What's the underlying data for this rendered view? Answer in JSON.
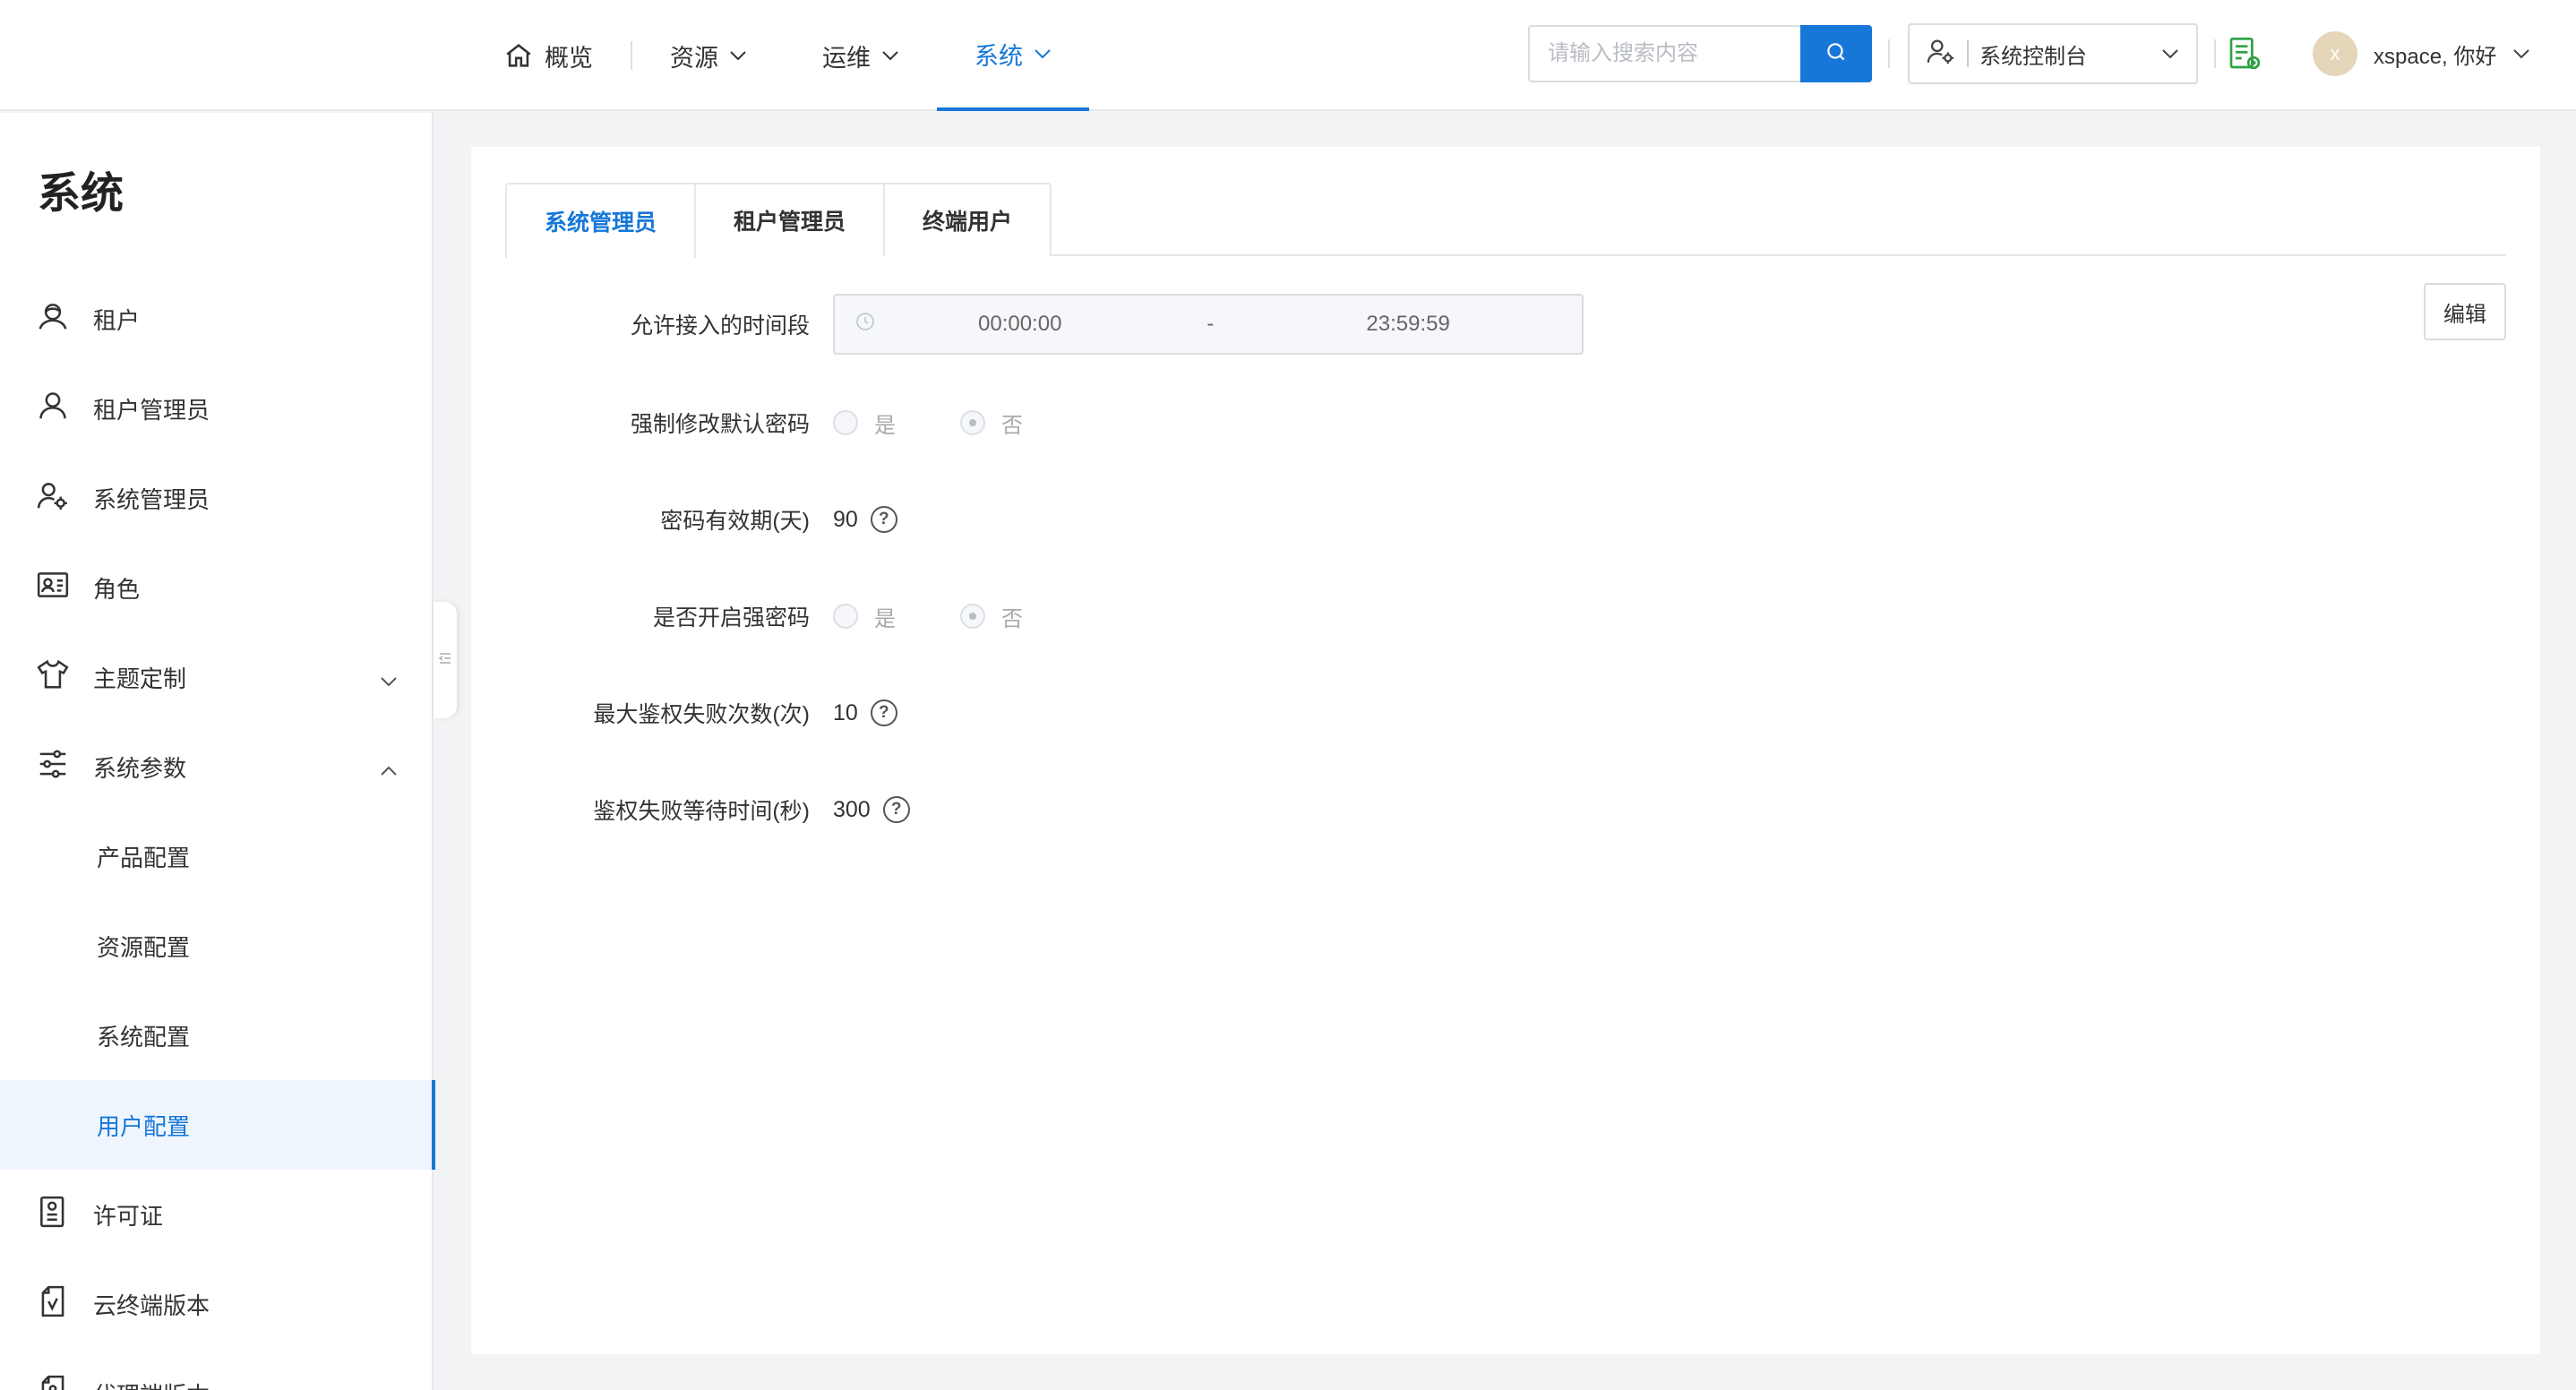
{
  "header": {
    "nav": [
      {
        "label": "概览",
        "icon": "home-icon",
        "active": false
      },
      {
        "label": "资源",
        "icon": "chevron-down-icon",
        "active": false
      },
      {
        "label": "运维",
        "icon": "chevron-down-icon",
        "active": false
      },
      {
        "label": "系统",
        "icon": "chevron-down-icon",
        "active": true
      }
    ],
    "search_placeholder": "请输入搜索内容",
    "console_label": "系统控制台",
    "user_initial": "x",
    "user_greeting": "xspace, 你好"
  },
  "sidebar": {
    "title": "系统",
    "items": [
      {
        "label": "租户",
        "icon": "tenant-icon"
      },
      {
        "label": "租户管理员",
        "icon": "user-icon"
      },
      {
        "label": "系统管理员",
        "icon": "admin-gear-icon"
      },
      {
        "label": "角色",
        "icon": "id-card-icon"
      },
      {
        "label": "主题定制",
        "icon": "shirt-icon",
        "expandable": true,
        "expanded": false
      },
      {
        "label": "系统参数",
        "icon": "sliders-icon",
        "expandable": true,
        "expanded": true
      },
      {
        "label": "产品配置",
        "sub": true
      },
      {
        "label": "资源配置",
        "sub": true
      },
      {
        "label": "系统配置",
        "sub": true
      },
      {
        "label": "用户配置",
        "sub": true,
        "active": true
      },
      {
        "label": "许可证",
        "icon": "license-icon"
      },
      {
        "label": "云终端版本",
        "icon": "cloud-terminal-icon"
      },
      {
        "label": "代理端版本",
        "icon": "agent-icon"
      }
    ]
  },
  "tabs": [
    {
      "label": "系统管理员",
      "active": true
    },
    {
      "label": "租户管理员",
      "active": false
    },
    {
      "label": "终端用户",
      "active": false
    }
  ],
  "edit_label": "编辑",
  "form": {
    "access_time_label": "允许接入的时间段",
    "access_time_start": "00:00:00",
    "access_time_sep": "-",
    "access_time_end": "23:59:59",
    "force_change_label": "强制修改默认密码",
    "force_change_yes": "是",
    "force_change_no": "否",
    "force_change_value": "否",
    "pwd_validity_label": "密码有效期(天)",
    "pwd_validity_value": "90",
    "strong_pwd_label": "是否开启强密码",
    "strong_pwd_yes": "是",
    "strong_pwd_no": "否",
    "strong_pwd_value": "否",
    "max_fail_label": "最大鉴权失败次数(次)",
    "max_fail_value": "10",
    "fail_wait_label": "鉴权失败等待时间(秒)",
    "fail_wait_value": "300"
  },
  "colors": {
    "primary": "#1677d9",
    "active_bg": "#eef5fd",
    "page_bg": "#f2f3f5",
    "doc_icon": "#2ea043"
  }
}
